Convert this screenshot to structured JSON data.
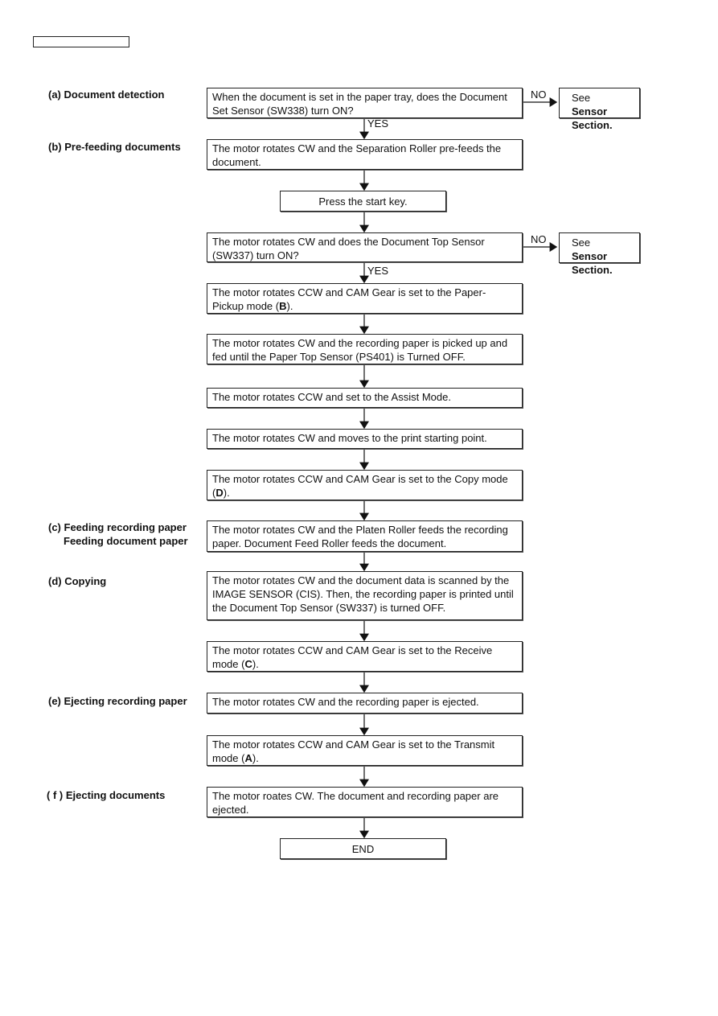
{
  "sections": {
    "a": "(a) Document detection",
    "b": "(b) Pre-feeding documents",
    "c1": "(c) Feeding recording paper",
    "c2": "Feeding document paper",
    "d": "(d) Copying",
    "e": "(e) Ejecting recording paper",
    "f": "( f ) Ejecting documents"
  },
  "steps": [
    "When the document is set in the paper tray, does the Document Set Sensor (SW338) turn ON?",
    "The motor rotates CW and the Separation Roller pre-feeds the document.",
    "Press the start key.",
    "The motor rotates CW and does the Document Top Sensor (SW337) turn ON?",
    "The motor rotates CCW and CAM Gear is set to the Paper-Pickup mode (B).",
    "The motor rotates CW and the recording paper is picked up and fed until the Paper Top Sensor (PS401) is Turned OFF.",
    "The motor rotates CCW and  set to the Assist Mode.",
    "The motor rotates CW and moves to the print starting point.",
    "The motor rotates CCW and CAM Gear is set to the Copy mode (D).",
    "The motor rotates CW and the Platen Roller feeds the recording paper. Document Feed Roller feeds the document.",
    "The motor rotates CW and the document data is scanned by the IMAGE SENSOR (CIS). Then, the recording paper is printed until the Document Top Sensor (SW337) is turned OFF.",
    "The motor rotates CCW and CAM Gear is set to the Receive mode (C).",
    "The motor rotates CW and the recording paper is ejected.",
    "The motor rotates CCW and CAM Gear is set to the Transmit mode (A).",
    "The motor roates CW. The document and recording paper are ejected.",
    "END"
  ],
  "side": {
    "see": "See",
    "sensor": "Sensor",
    "section": "Section."
  },
  "branches": {
    "no": "NO",
    "yes": "YES"
  }
}
